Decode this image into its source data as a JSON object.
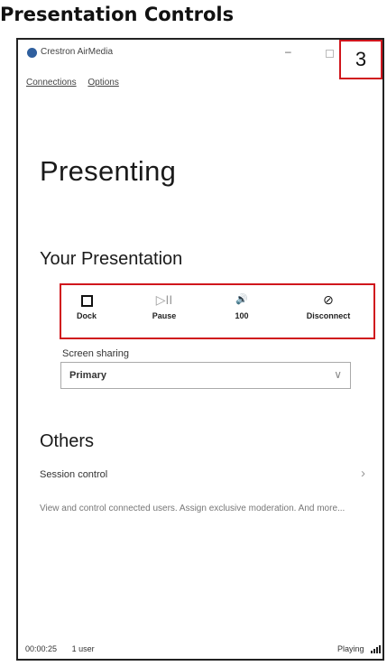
{
  "document": {
    "title": "Presentation Controls"
  },
  "window": {
    "app_name": "Crestron AirMedia",
    "minimize_glyph": "–",
    "menu": [
      {
        "label": "Connections"
      },
      {
        "label": "Options"
      }
    ],
    "callout_number": "3"
  },
  "main": {
    "heading": "Presenting",
    "your_presentation": {
      "title": "Your Presentation",
      "controls": [
        {
          "label": "Dock",
          "icon": "stop-square-icon",
          "glyph": ""
        },
        {
          "label": "Pause",
          "icon": "play-pause-icon",
          "glyph": "▷II"
        },
        {
          "label": "100",
          "icon": "volume-icon",
          "glyph": "🔊"
        },
        {
          "label": "Disconnect",
          "icon": "disconnect-icon",
          "glyph": "⊘"
        }
      ],
      "screen_sharing": {
        "label": "Screen sharing",
        "value": "Primary",
        "chevron": "∨"
      }
    },
    "others": {
      "title": "Others",
      "session_control": {
        "title": "Session control",
        "chevron": "›",
        "description": "View and control connected users. Assign exclusive moderation. And more..."
      }
    }
  },
  "status_bar": {
    "elapsed": "00:00:25",
    "users": "1 user",
    "state": "Playing"
  },
  "colors": {
    "callout_border": "#d0161d",
    "app_icon": "#2f5f9e"
  }
}
